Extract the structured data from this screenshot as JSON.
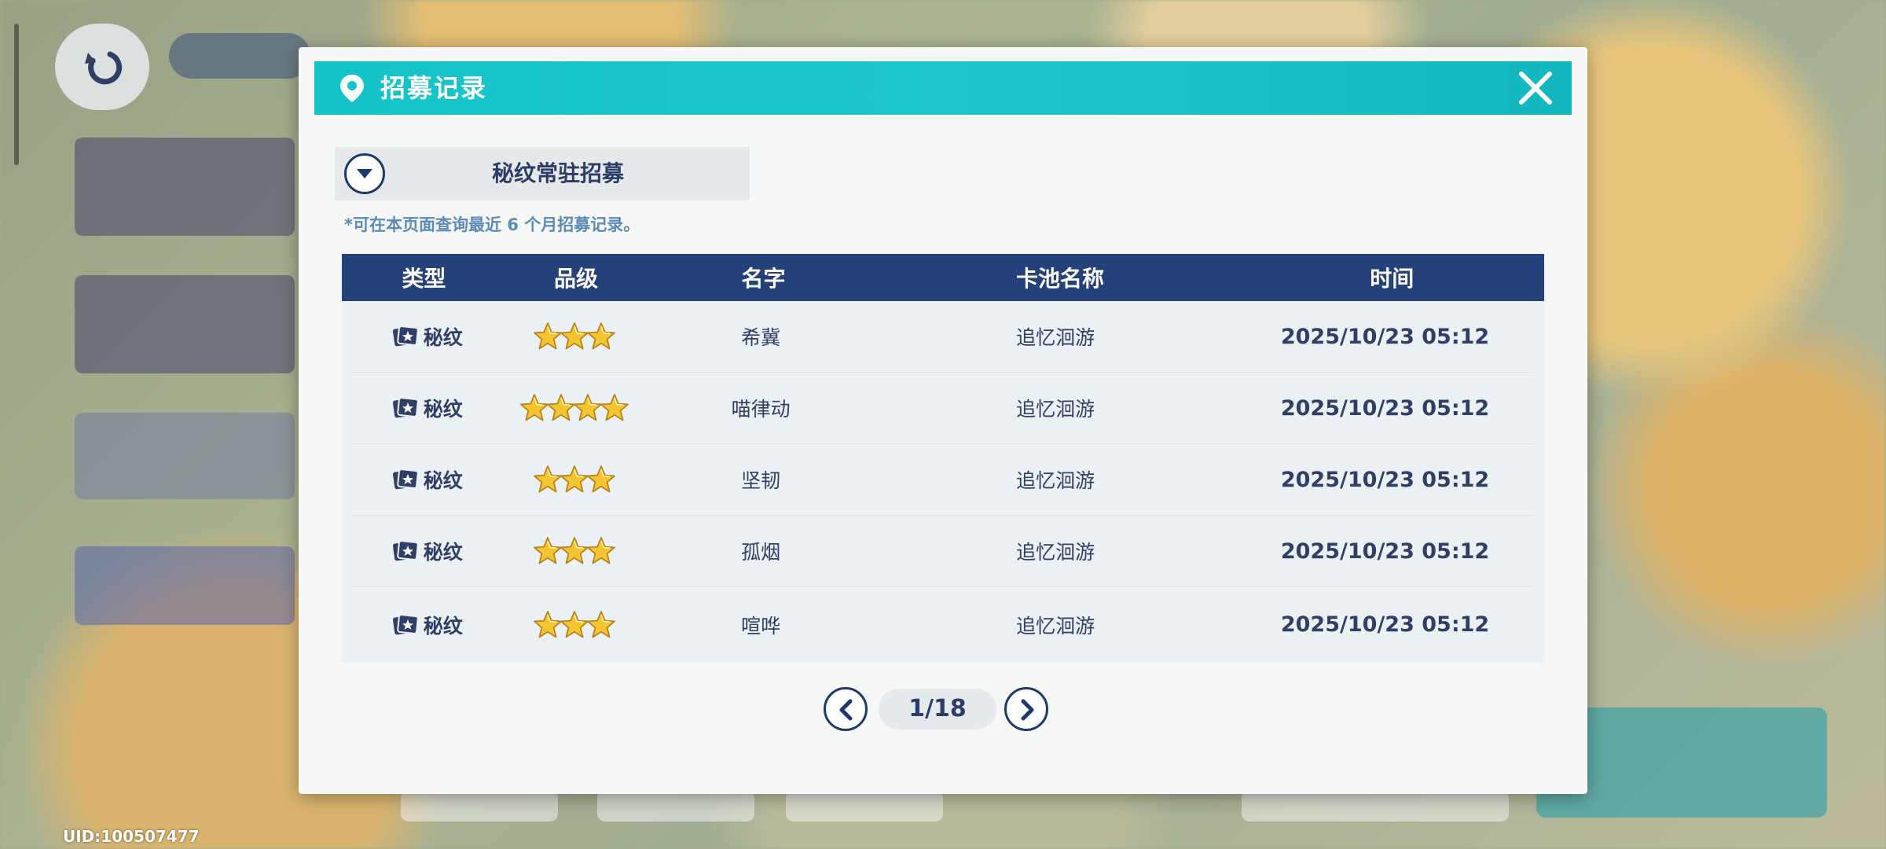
{
  "dialog": {
    "title": "招募记录",
    "pool_selector": "秘纹常驻招募",
    "note": "*可在本页面查询最近 6 个月招募记录。"
  },
  "table": {
    "headers": {
      "type": "类型",
      "grade": "品级",
      "name": "名字",
      "pool": "卡池名称",
      "time": "时间"
    },
    "rows": [
      {
        "type": "秘纹",
        "stars": 3,
        "name": "希冀",
        "pool": "追忆洄游",
        "time": "2025/10/23 05:12"
      },
      {
        "type": "秘纹",
        "stars": 4,
        "name": "喵律动",
        "pool": "追忆洄游",
        "time": "2025/10/23 05:12"
      },
      {
        "type": "秘纹",
        "stars": 3,
        "name": "坚韧",
        "pool": "追忆洄游",
        "time": "2025/10/23 05:12"
      },
      {
        "type": "秘纹",
        "stars": 3,
        "name": "孤烟",
        "pool": "追忆洄游",
        "time": "2025/10/23 05:12"
      },
      {
        "type": "秘纹",
        "stars": 3,
        "name": "喧哗",
        "pool": "追忆洄游",
        "time": "2025/10/23 05:12"
      }
    ]
  },
  "pagination": {
    "current": "1/18"
  },
  "footer": {
    "uid": "UID:100507477"
  },
  "icons": {
    "header": "location-pin-icon",
    "close": "close-icon",
    "selector": "chevron-down-icon",
    "type": "card-icon",
    "grade": "star-icon",
    "prev": "chevron-left-icon",
    "next": "chevron-right-icon"
  },
  "colors": {
    "header_teal": "#13c3c8",
    "table_header_navy": "#25417a",
    "text_navy": "#2f3f66",
    "note_blue": "#5b8bb6",
    "star_gold": "#f4c531"
  }
}
